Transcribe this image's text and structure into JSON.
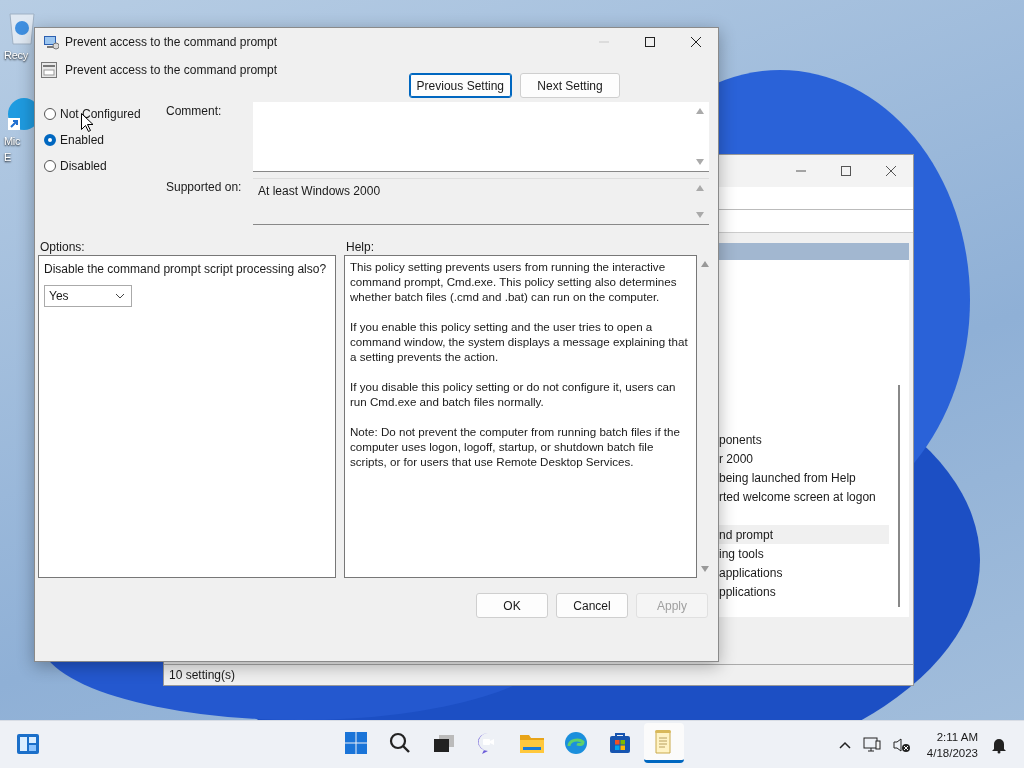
{
  "desktop_icons": [
    {
      "kind": "recycle",
      "lines": [
        "Recy"
      ]
    },
    {
      "kind": "edge",
      "lines": [
        "Mic",
        "E"
      ]
    }
  ],
  "background_window": {
    "list_items": [
      {
        "text": "ponents",
        "selected": false
      },
      {
        "text": "r 2000",
        "selected": false
      },
      {
        "text": "being launched from Help",
        "selected": false
      },
      {
        "text": "rted welcome screen at logon",
        "selected": false
      },
      {
        "text": "nd prompt",
        "selected": true
      },
      {
        "text": "ing tools",
        "selected": false
      },
      {
        "text": "applications",
        "selected": false
      },
      {
        "text": "pplications",
        "selected": false
      }
    ],
    "status": "10 setting(s)"
  },
  "dialog": {
    "title": "Prevent access to the command prompt",
    "setting_name": "Prevent access to the command prompt",
    "nav_buttons": [
      {
        "label": "Previous Setting",
        "focused": true
      },
      {
        "label": "Next Setting",
        "focused": false
      }
    ],
    "states": [
      {
        "label": "Not Configured",
        "selected": false
      },
      {
        "label": "Enabled",
        "selected": true
      },
      {
        "label": "Disabled",
        "selected": false
      }
    ],
    "comment_label": "Comment:",
    "supported_label": "Supported on:",
    "supported_value": "At least Windows 2000",
    "options_label": "Options:",
    "help_label": "Help:",
    "option": {
      "prompt": "Disable the command prompt script processing also?",
      "value": "Yes"
    },
    "help_paragraphs": [
      "This policy setting prevents users from running the interactive command prompt, Cmd.exe.  This policy setting also determines whether batch files (.cmd and .bat) can run on the computer.",
      "If you enable this policy setting and the user tries to open a command window, the system displays a message explaining that a setting prevents the action.",
      "If you disable this policy setting or do not configure it, users can run Cmd.exe and batch files normally.",
      "Note: Do not prevent the computer from running batch files if the computer uses logon, logoff, startup, or shutdown batch file scripts, or for users that use Remote Desktop Services."
    ],
    "buttons": [
      {
        "label": "OK",
        "disabled": false
      },
      {
        "label": "Cancel",
        "disabled": false
      },
      {
        "label": "Apply",
        "disabled": true
      }
    ]
  },
  "taskbar": {
    "apps": [
      {
        "kind": "start",
        "active": false
      },
      {
        "kind": "search",
        "active": false
      },
      {
        "kind": "taskview",
        "active": false
      },
      {
        "kind": "chat",
        "active": false
      },
      {
        "kind": "explorer",
        "active": false
      },
      {
        "kind": "edge",
        "active": false
      },
      {
        "kind": "store",
        "active": false
      },
      {
        "kind": "notepad",
        "active": true
      }
    ],
    "clock": {
      "time": "2:11 AM",
      "date": "4/18/2023"
    }
  }
}
